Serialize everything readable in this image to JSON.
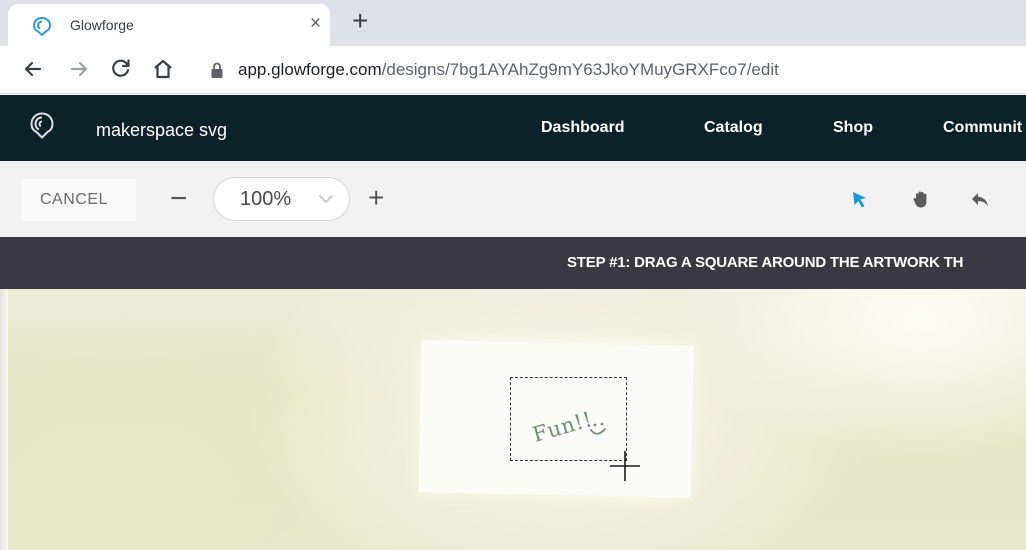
{
  "browser": {
    "tab": {
      "title": "Glowforge",
      "close": "×"
    },
    "new_tab": "+",
    "url": {
      "host": "app.glowforge.com",
      "path": "/designs/7bg1AYAhZg9mY63JkoYMuyGRXFco7/edit"
    }
  },
  "app": {
    "design_title": "makerspace svg",
    "nav": [
      "Dashboard",
      "Catalog",
      "Shop",
      "Communit"
    ]
  },
  "editor": {
    "cancel_label": "CANCEL",
    "zoom_minus": "−",
    "zoom_value": "100%",
    "zoom_plus": "+",
    "tools": [
      "select-arrow-icon",
      "hand-pan-icon",
      "undo-icon"
    ],
    "active_tool_color": "#1a9bd7"
  },
  "banner": {
    "step_text": "STEP #1: DRAG A SQUARE AROUND THE ARTWORK TH"
  },
  "camera_view": {
    "handwriting": "Fun!!"
  }
}
